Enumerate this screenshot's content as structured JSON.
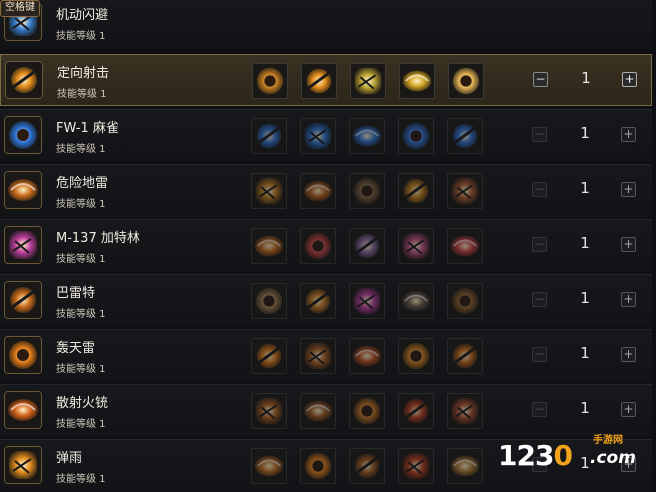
{
  "spacebar_tag": "空格键",
  "skills": [
    {
      "name": "机动闪避",
      "level": "技能等级 1",
      "count": "",
      "selected": false,
      "theme": "#3a7fd0",
      "runes": []
    },
    {
      "name": "定向射击",
      "level": "技能等级 1",
      "count": "1",
      "selected": true,
      "theme": "#e08a1a",
      "runes": [
        "#c07a20",
        "#3a7fd0",
        "#b8a030",
        "#d0a020",
        "#e0b050"
      ]
    },
    {
      "name": "FW-1 麻雀",
      "level": "技能等级 1",
      "count": "1",
      "selected": false,
      "theme": "#2f74d6",
      "runes": [
        "#2f74d6",
        "#2f74d6",
        "#2f74d6",
        "#2f74d6",
        "#2f74d6"
      ]
    },
    {
      "name": "危险地雷",
      "level": "技能等级 1",
      "count": "1",
      "selected": false,
      "theme": "#c86a1a",
      "runes": [
        "#c07a20",
        "#b86018",
        "#7a5a3a",
        "#c8801a",
        "#b05a30"
      ]
    },
    {
      "name": "M-137 加特林",
      "level": "技能等级 1",
      "count": "1",
      "selected": false,
      "theme": "#c040a0",
      "runes": [
        "#c040a0",
        "#c04040",
        "#8a6aa0",
        "#c05080",
        "#d04040"
      ]
    },
    {
      "name": "巴雷特",
      "level": "技能等级 1",
      "count": "1",
      "selected": false,
      "theme": "#c86a1a",
      "runes": [
        "#9a7a4a",
        "#c87a20",
        "#8a6a3a",
        "#6a5a4a",
        "#8a5a2a"
      ]
    },
    {
      "name": "轰天雷",
      "level": "技能等级 1",
      "count": "1",
      "selected": false,
      "theme": "#e07a18",
      "runes": [
        "#e07a18",
        "#b06020",
        "#c05020",
        "#d08020",
        "#b07a30"
      ]
    },
    {
      "name": "散射火铳",
      "level": "技能等级 1",
      "count": "1",
      "selected": false,
      "theme": "#d06018",
      "runes": [
        "#b06020",
        "#a05a20",
        "#c07020",
        "#c04020",
        "#b05030"
      ]
    },
    {
      "name": "弹雨",
      "level": "技能等级 1",
      "count": "1",
      "selected": false,
      "theme": "#e08a1a",
      "runes": [
        "#c07020",
        "#b06020",
        "#a05a20",
        "#c04020",
        "#b07a30"
      ]
    }
  ],
  "controls": {
    "minus": "−",
    "plus": "+"
  },
  "watermark": {
    "main_a": "123",
    "main_b": "0",
    "domain": ".com",
    "sub": "手游网"
  }
}
